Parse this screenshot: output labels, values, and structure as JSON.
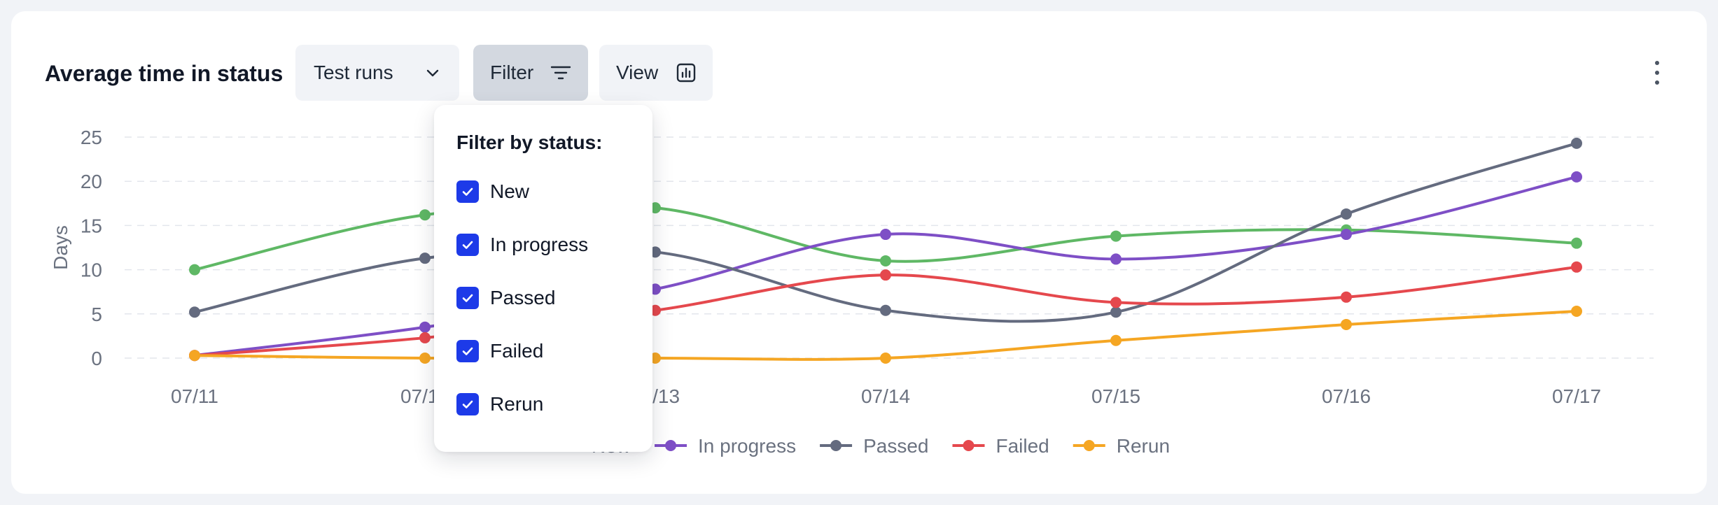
{
  "header": {
    "title": "Average time in status",
    "dropdown_label": "Test runs",
    "filter_label": "Filter",
    "view_label": "View"
  },
  "filter_popover": {
    "title": "Filter by status:",
    "options": [
      {
        "label": "New",
        "checked": true
      },
      {
        "label": "In progress",
        "checked": true
      },
      {
        "label": "Passed",
        "checked": true
      },
      {
        "label": "Failed",
        "checked": true
      },
      {
        "label": "Rerun",
        "checked": true
      }
    ]
  },
  "icons": {
    "dropdown": "chevron-down-icon",
    "filter": "filter-lines-icon",
    "view": "bar-chart-icon",
    "menu": "kebab-menu-icon",
    "checkbox": "checkmark-icon"
  },
  "colors": {
    "New": "#5fb865",
    "In progress": "#7e4fc6",
    "Passed": "#646b7f",
    "Failed": "#e5484d",
    "Rerun": "#f5a623",
    "checkbox": "#1d3ae8"
  },
  "chart_data": {
    "type": "line",
    "ylabel": "Days",
    "xlabel": "",
    "ylim": [
      0,
      25
    ],
    "yticks": [
      0,
      5,
      10,
      15,
      20,
      25
    ],
    "grid": true,
    "legend_position": "bottom",
    "categories": [
      "07/11",
      "07/12",
      "07/13",
      "07/14",
      "07/15",
      "07/16",
      "07/17"
    ],
    "series": [
      {
        "name": "New",
        "values": [
          10,
          16.2,
          17,
          11,
          13.8,
          14.5,
          13
        ]
      },
      {
        "name": "In progress",
        "values": [
          0.3,
          3.5,
          7.8,
          14,
          11.2,
          14,
          20.5
        ]
      },
      {
        "name": "Passed",
        "values": [
          5.2,
          11.3,
          12,
          5.4,
          5.2,
          16.3,
          24.3
        ]
      },
      {
        "name": "Failed",
        "values": [
          0.3,
          2.3,
          5.4,
          9.4,
          6.3,
          6.9,
          10.3
        ]
      },
      {
        "name": "Rerun",
        "values": [
          0.3,
          0,
          0,
          0,
          2,
          3.8,
          5.3
        ]
      }
    ]
  }
}
